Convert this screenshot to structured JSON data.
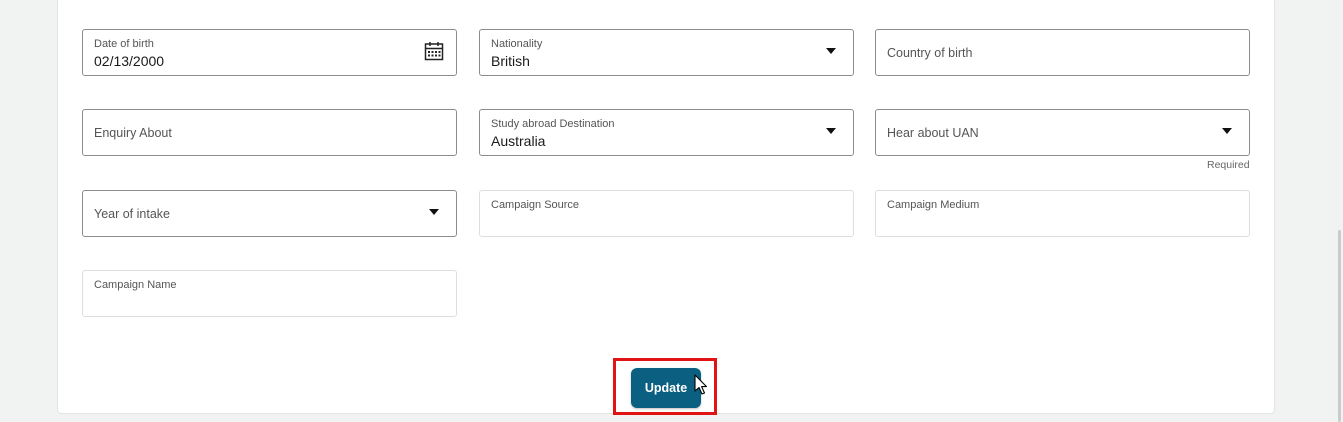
{
  "form": {
    "date_of_birth": {
      "label": "Date of birth",
      "value": "02/13/2000"
    },
    "nationality": {
      "label": "Nationality",
      "value": "British"
    },
    "country_of_birth": {
      "placeholder": "Country of birth"
    },
    "enquiry_about": {
      "placeholder": "Enquiry About"
    },
    "study_destination": {
      "label": "Study abroad Destination",
      "value": "Australia"
    },
    "hear_about": {
      "placeholder": "Hear about UAN",
      "helper": "Required"
    },
    "year_of_intake": {
      "placeholder": "Year of intake"
    },
    "campaign_source": {
      "label": "Campaign Source"
    },
    "campaign_medium": {
      "label": "Campaign Medium"
    },
    "campaign_name": {
      "label": "Campaign Name"
    }
  },
  "actions": {
    "update_label": "Update"
  },
  "colors": {
    "primary_button": "#0b5f80",
    "highlight_box": "#e01414",
    "page_background": "#f1f2f2"
  },
  "icons": {
    "date_picker": "calendar-icon",
    "dropdown": "caret-down-icon",
    "pointer": "mouse-cursor-icon"
  }
}
